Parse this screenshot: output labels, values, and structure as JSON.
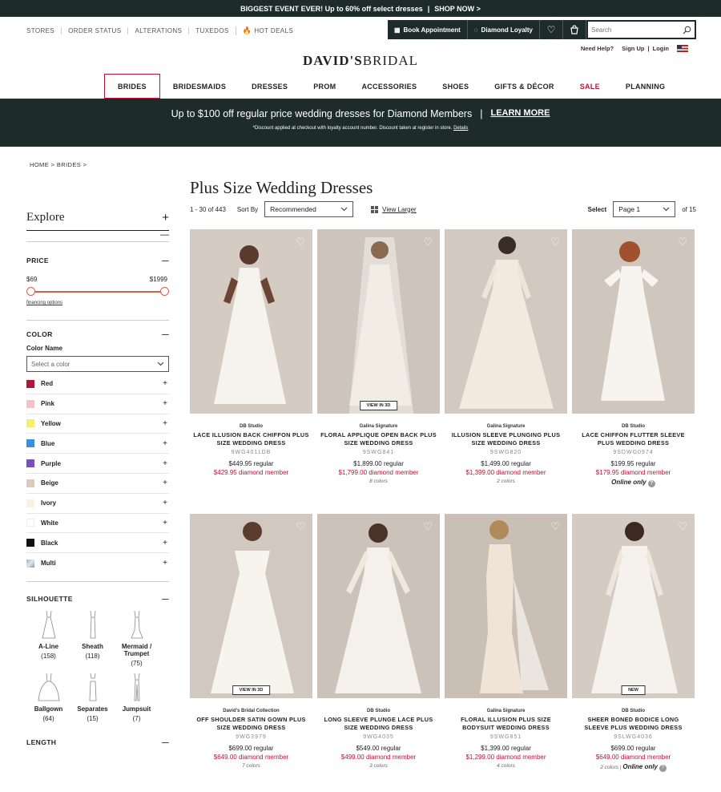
{
  "promo": {
    "text": "BIGGEST EVENT EVER! Up to 60% off select dresses",
    "sep": "|",
    "cta": "SHOP NOW >"
  },
  "util": {
    "links": [
      "STORES",
      "ORDER STATUS",
      "ALTERATIONS",
      "TUXEDOS",
      "HOT DEALS"
    ],
    "book": "Book Appointment",
    "loyalty": "Diamond Loyalty",
    "search_placeholder": "Search"
  },
  "account": {
    "help": "Need Help?",
    "signup": "Sign Up",
    "sep": "|",
    "login": "Login"
  },
  "logo": {
    "a": "DAVID'S",
    "b": "BRIDAL"
  },
  "nav": [
    "BRIDES",
    "BRIDESMAIDS",
    "DRESSES",
    "PROM",
    "ACCESSORIES",
    "SHOES",
    "GIFTS & DÉCOR",
    "SALE",
    "PLANNING"
  ],
  "banner": {
    "headline": "Up to $100 off regular price wedding dresses for Diamond Members",
    "sep": "|",
    "cta": "LEARN MORE",
    "fine": "*Discount applied at checkout with loyalty account number. Discount taken at register in store.",
    "details": "Details"
  },
  "breadcrumb": "HOME >  BRIDES >",
  "sidebar": {
    "explore": "Explore",
    "price": {
      "title": "PRICE",
      "min": "$69",
      "max": "$1999",
      "financing": "financing options"
    },
    "color": {
      "title": "COLOR",
      "name": "Color Name",
      "placeholder": "Select a color",
      "items": [
        {
          "label": "Red",
          "hex": "#b0183a"
        },
        {
          "label": "Pink",
          "hex": "#f3c2c9"
        },
        {
          "label": "Yellow",
          "hex": "#f7ef6b"
        },
        {
          "label": "Blue",
          "hex": "#3b8fe0"
        },
        {
          "label": "Purple",
          "hex": "#7a4fc2"
        },
        {
          "label": "Beige",
          "hex": "#dccbb8"
        },
        {
          "label": "Ivory",
          "hex": "#fbf0e6"
        },
        {
          "label": "White",
          "hex": "#ffffff"
        },
        {
          "label": "Black",
          "hex": "#111111"
        },
        {
          "label": "Multi",
          "hex": "#9fb6c6"
        }
      ]
    },
    "silhouette": {
      "title": "SILHOUETTE",
      "items": [
        {
          "label": "A-Line",
          "count": "(158)"
        },
        {
          "label": "Sheath",
          "count": "(118)"
        },
        {
          "label": "Mermaid / Trumpet",
          "count": "(75)"
        },
        {
          "label": "Ballgown",
          "count": "(64)"
        },
        {
          "label": "Separates",
          "count": "(15)"
        },
        {
          "label": "Jumpsuit",
          "count": "(7)"
        }
      ]
    },
    "length": "LENGTH"
  },
  "listing": {
    "title": "Plus Size Wedding Dresses",
    "count": "1 - 30 of 443",
    "sort_label": "Sort By",
    "sort_value": "Recommended",
    "view": "View Larger",
    "select": "Select",
    "page": "Page 1",
    "of": "of 15"
  },
  "products": [
    {
      "brand": "DB Studio",
      "name": "LACE ILLUSION BACK CHIFFON PLUS SIZE WEDDING DRESS",
      "sku": "9WG4011DB",
      "price": "$449.95 regular",
      "member": "$429.95 diamond member",
      "extra": "",
      "badge": ""
    },
    {
      "brand": "Galina Signature",
      "name": "FLORAL APPLIQUE OPEN BACK PLUS SIZE WEDDING DRESS",
      "sku": "9SWG841",
      "price": "$1,899.00 regular",
      "member": "$1,799.00 diamond member",
      "extra": "8 colors",
      "badge": "VIEW IN 3D"
    },
    {
      "brand": "Galina Signature",
      "name": "ILLUSION SLEEVE PLUNGING PLUS SIZE WEDDING DRESS",
      "sku": "9SWG820",
      "price": "$1,499.00 regular",
      "member": "$1,399.00 diamond member",
      "extra": "2 colors",
      "badge": ""
    },
    {
      "brand": "DB Studio",
      "name": "LACE CHIFFON FLUTTER SLEEVE PLUS WEDDING DRESS",
      "sku": "9SDWG0974",
      "price": "$199.95 regular",
      "member": "$179.95 diamond member",
      "extra": "",
      "online": "Online only",
      "badge": ""
    },
    {
      "brand": "David's Bridal Collection",
      "name": "OFF SHOULDER SATIN GOWN PLUS SIZE WEDDING DRESS",
      "sku": "9WG3979",
      "price": "$699.00 regular",
      "member": "$649.00 diamond member",
      "extra": "7 colors",
      "badge": "VIEW IN 3D"
    },
    {
      "brand": "DB Studio",
      "name": "LONG SLEEVE PLUNGE LACE PLUS SIZE WEDDING DRESS",
      "sku": "9WG4035",
      "price": "$549.00 regular",
      "member": "$499.00 diamond member",
      "extra": "3 colors",
      "badge": ""
    },
    {
      "brand": "Galina Signature",
      "name": "FLORAL ILLUSION PLUS SIZE BODYSUIT WEDDING DRESS",
      "sku": "9SWG851",
      "price": "$1,399.00 regular",
      "member": "$1,299.00 diamond member",
      "extra": "4 colors",
      "badge": ""
    },
    {
      "brand": "DB Studio",
      "name": "SHEER BONED BODICE LONG SLEEVE PLUS WEDDING DRESS",
      "sku": "9SLWG4036",
      "price": "$699.00 regular",
      "member": "$649.00 diamond member",
      "extra": "2 colors",
      "online": "Online only",
      "badge": "NEW"
    }
  ],
  "colors": {
    "dark": "#1d2b2a",
    "sale": "#c8102e",
    "slider": "#e05a48"
  }
}
